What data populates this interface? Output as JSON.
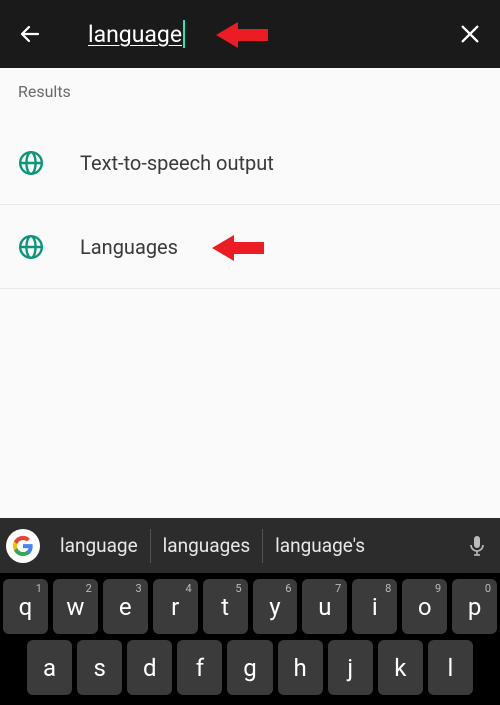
{
  "search": {
    "value": "language"
  },
  "results": {
    "header": "Results",
    "items": [
      {
        "label": "Text-to-speech output",
        "icon": "globe"
      },
      {
        "label": "Languages",
        "icon": "globe"
      }
    ]
  },
  "keyboard": {
    "suggestions": [
      "language",
      "languages",
      "language's"
    ],
    "row1": [
      {
        "k": "q",
        "n": "1"
      },
      {
        "k": "w",
        "n": "2"
      },
      {
        "k": "e",
        "n": "3"
      },
      {
        "k": "r",
        "n": "4"
      },
      {
        "k": "t",
        "n": "5"
      },
      {
        "k": "y",
        "n": "6"
      },
      {
        "k": "u",
        "n": "7"
      },
      {
        "k": "i",
        "n": "8"
      },
      {
        "k": "o",
        "n": "9"
      },
      {
        "k": "p",
        "n": "0"
      }
    ],
    "row2": [
      {
        "k": "a"
      },
      {
        "k": "s"
      },
      {
        "k": "d"
      },
      {
        "k": "f"
      },
      {
        "k": "g"
      },
      {
        "k": "h"
      },
      {
        "k": "j"
      },
      {
        "k": "k"
      },
      {
        "k": "l"
      }
    ]
  },
  "colors": {
    "accent": "#1de9b6",
    "globe": "#0d9578",
    "annotation": "#ec1c24"
  }
}
